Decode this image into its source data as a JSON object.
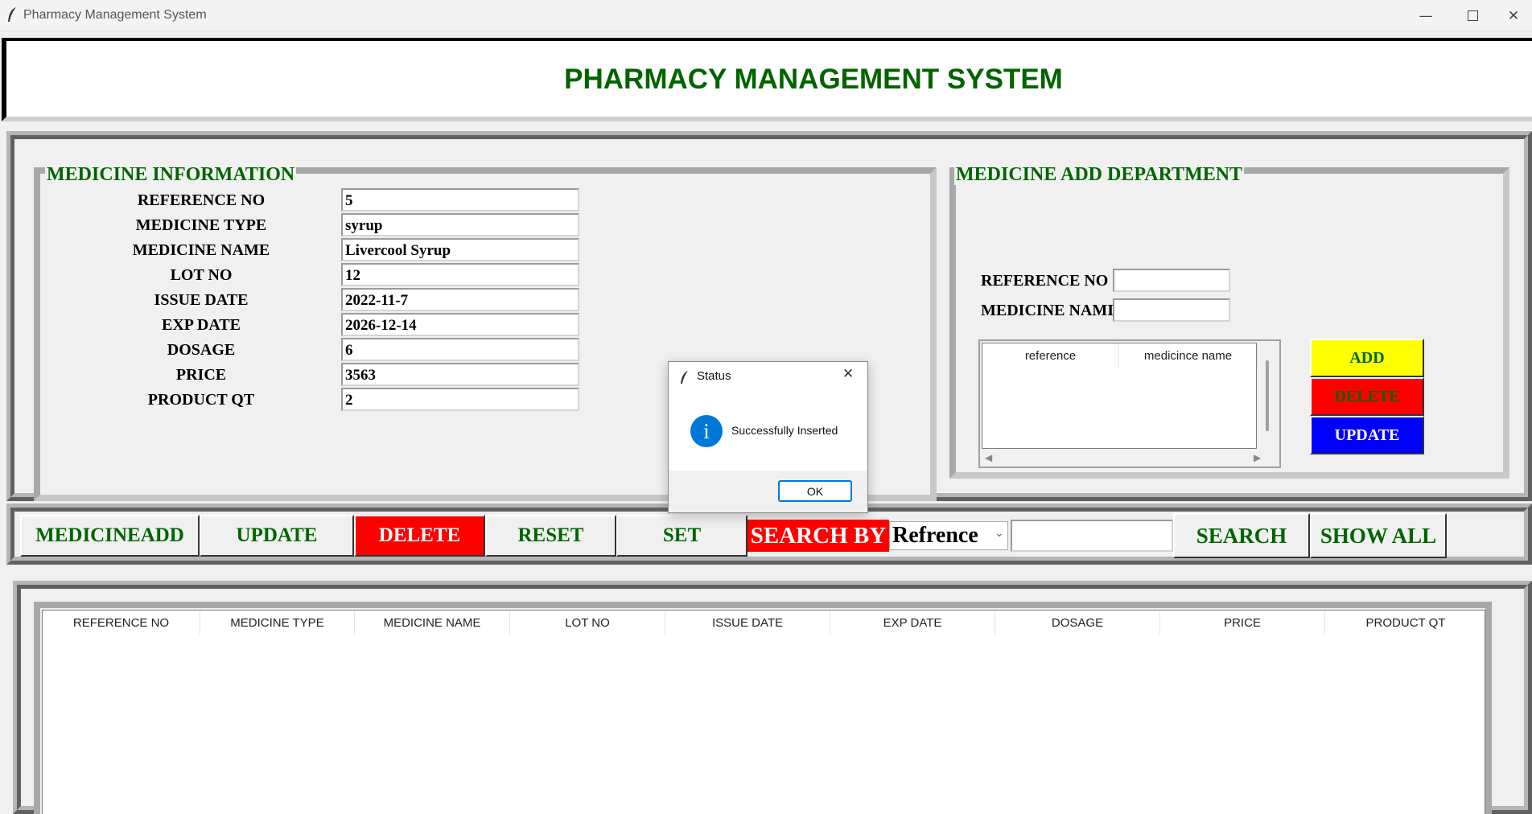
{
  "window": {
    "title": "Pharmacy Management System"
  },
  "header": {
    "title": "PHARMACY MANAGEMENT SYSTEM"
  },
  "medicine_info": {
    "legend": "MEDICINE INFORMATION",
    "fields": [
      {
        "label": "REFERENCE NO",
        "value": "5"
      },
      {
        "label": "MEDICINE TYPE",
        "value": "syrup"
      },
      {
        "label": "MEDICINE NAME",
        "value": "Livercool Syrup"
      },
      {
        "label": "LOT NO",
        "value": "12"
      },
      {
        "label": "ISSUE DATE",
        "value": "2022-11-7"
      },
      {
        "label": "EXP DATE",
        "value": "2026-12-14"
      },
      {
        "label": "DOSAGE",
        "value": "6"
      },
      {
        "label": "PRICE",
        "value": "3563"
      },
      {
        "label": "PRODUCT QT",
        "value": "2"
      }
    ]
  },
  "add_department": {
    "legend": "MEDICINE ADD DEPARTMENT",
    "ref_label": "REFERENCE NO",
    "ref_value": "",
    "name_label": "MEDICINE NAMI",
    "name_value": "",
    "table_headers": [
      "reference",
      "medicince name"
    ],
    "buttons": {
      "add": "ADD",
      "delete": "DELETE",
      "update": "UPDATE"
    },
    "colors": {
      "add": "#ffff00",
      "delete": "#ff0000",
      "update": "#0000ff"
    }
  },
  "toolbar": {
    "buttons": [
      "MEDICINEADD",
      "UPDATE",
      "DELETE",
      "RESET",
      "SET"
    ],
    "search_by_label": "SEARCH BY",
    "search_by_selected": "Refrence",
    "search_value": "",
    "search_button": "SEARCH",
    "show_all_button": "SHOW ALL"
  },
  "main_table": {
    "headers": [
      "REFERENCE NO",
      "MEDICINE TYPE",
      "MEDICINE NAME",
      "LOT NO",
      "ISSUE DATE",
      "EXP DATE",
      "DOSAGE",
      "PRICE",
      "PRODUCT QT"
    ]
  },
  "dialog": {
    "title": "Status",
    "message": "Successfully Inserted",
    "ok_label": "OK"
  },
  "colors": {
    "accent_green": "#006400",
    "danger_red": "#ff0000",
    "dialog_blue": "#0078d7"
  }
}
